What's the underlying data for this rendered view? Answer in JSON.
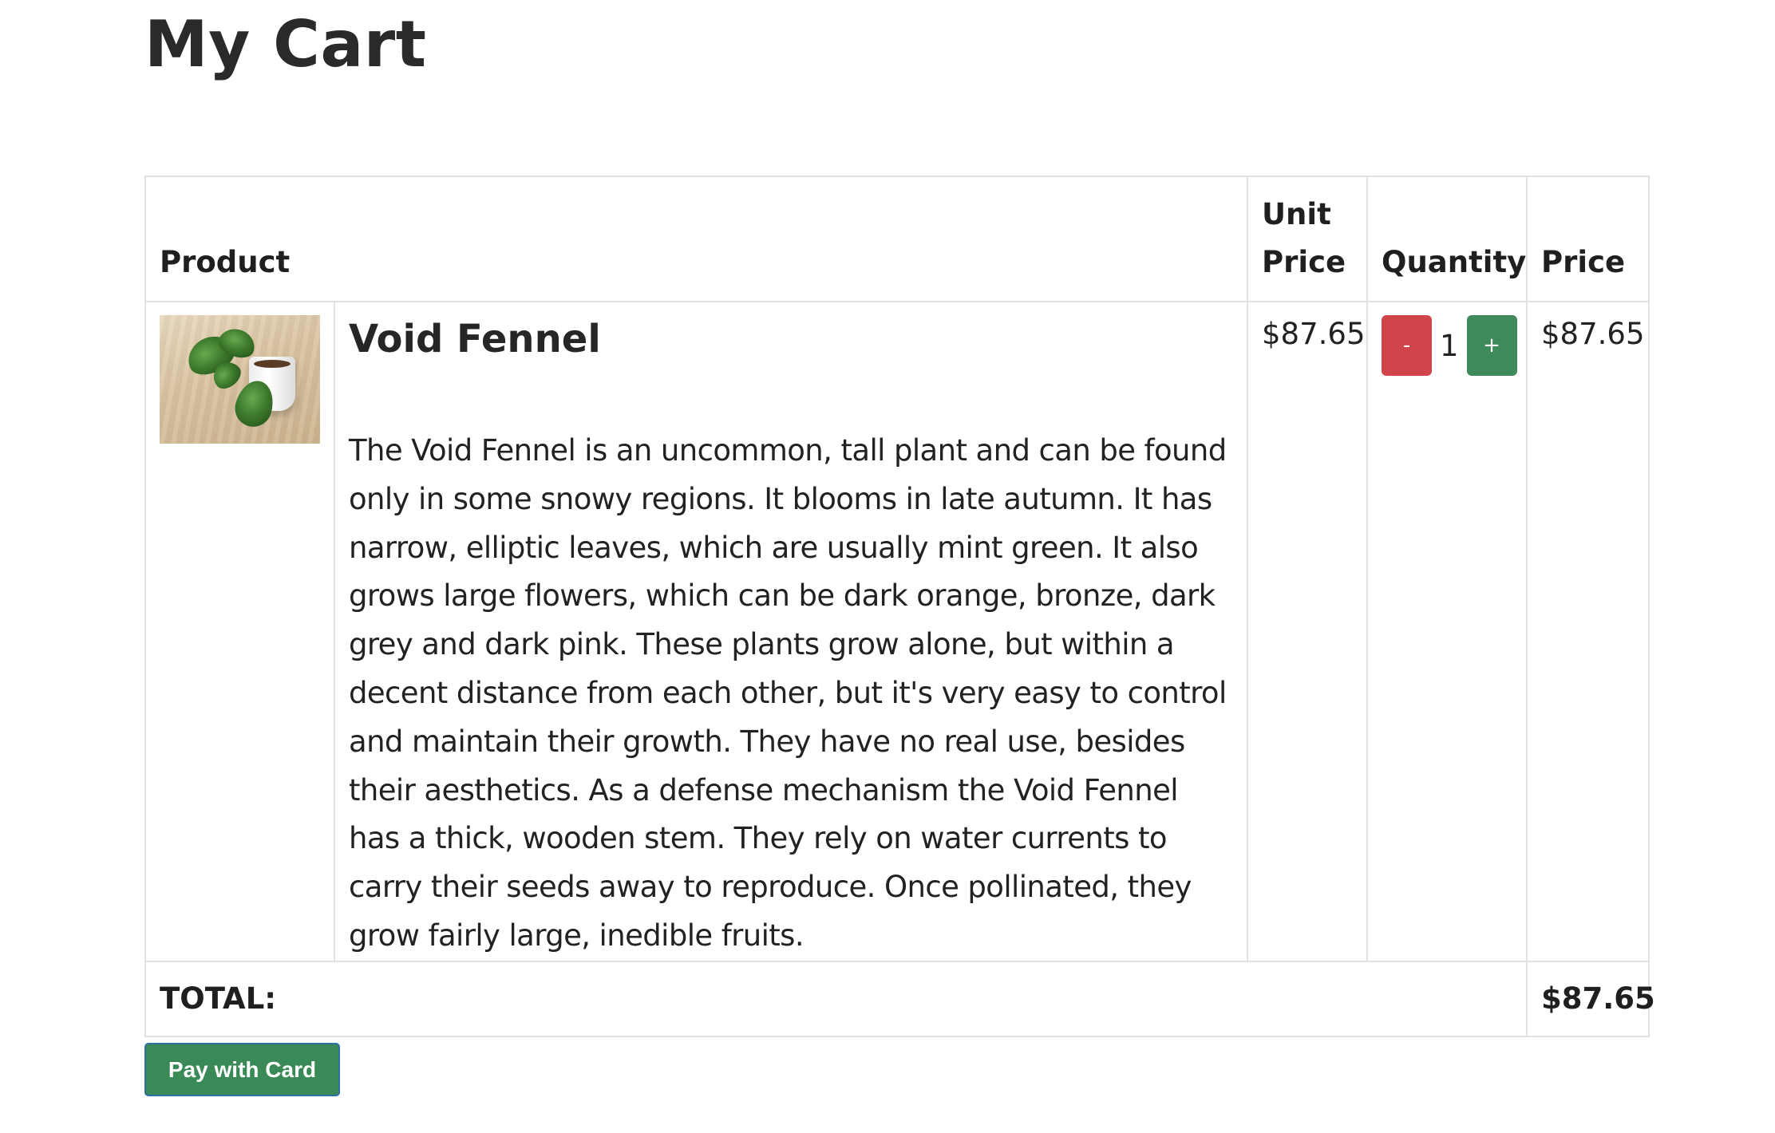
{
  "page": {
    "title": "My Cart"
  },
  "table": {
    "headers": {
      "product": "Product",
      "unit_price": "Unit Price",
      "quantity": "Quantity",
      "price": "Price"
    },
    "items": [
      {
        "name": "Void Fennel",
        "image_icon": "plant-thumbnail",
        "description": "The Void Fennel is an uncommon, tall plant and can be found only in some snowy regions. It blooms in late autumn. It has narrow, elliptic leaves, which are usually mint green. It also grows large flowers, which can be dark orange, bronze, dark grey and dark pink. These plants grow alone, but within a decent distance from each other, but it's very easy to control and maintain their growth. They have no real use, besides their aesthetics. As a defense mechanism the Void Fennel has a thick, wooden stem. They rely on water currents to carry their seeds away to reproduce. Once pollinated, they grow fairly large, inedible fruits.",
        "unit_price": "$87.65",
        "quantity": "1",
        "decrement_label": "-",
        "increment_label": "+",
        "price": "$87.65"
      }
    ],
    "total_label": "TOTAL:",
    "total_value": "$87.65"
  },
  "actions": {
    "pay_label": "Pay with Card"
  },
  "colors": {
    "decrement_button": "#d0454c",
    "increment_button": "#3f8a5a",
    "pay_button": "#3a8a58",
    "table_border": "#e2e2e2"
  }
}
